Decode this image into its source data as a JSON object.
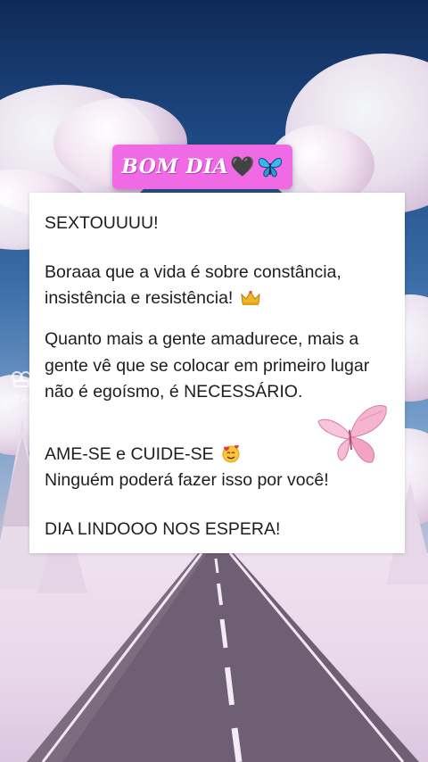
{
  "banner": {
    "text": "BOM DIA",
    "heart": "🖤",
    "butterfly_icon": "blue-butterfly-icon",
    "background_color": "#f06ae6"
  },
  "card": {
    "lines": [
      "SEXTOUUUU!",
      "Boraaa que a vida é sobre constância,",
      "insistência e resistência!",
      "Quanto mais a gente amadurece, mais a",
      "gente vê que se colocar em primeiro lugar",
      "não é egoísmo, é NECESSÁRIO.",
      "AME-SE e CUIDE-SE",
      "Ninguém poderá fazer isso por você!",
      "DIA LINDOOO NOS ESPERA!"
    ],
    "emoji": {
      "crown": "crown-icon",
      "face": "smiling-face-with-hearts-icon",
      "butterfly": "pink-butterfly-icon"
    }
  },
  "watermark": {
    "name": "@Ar"
  },
  "colors": {
    "sky_top": "#0f2a57",
    "snow": "#efe2ef",
    "road": "#6f5f74"
  }
}
